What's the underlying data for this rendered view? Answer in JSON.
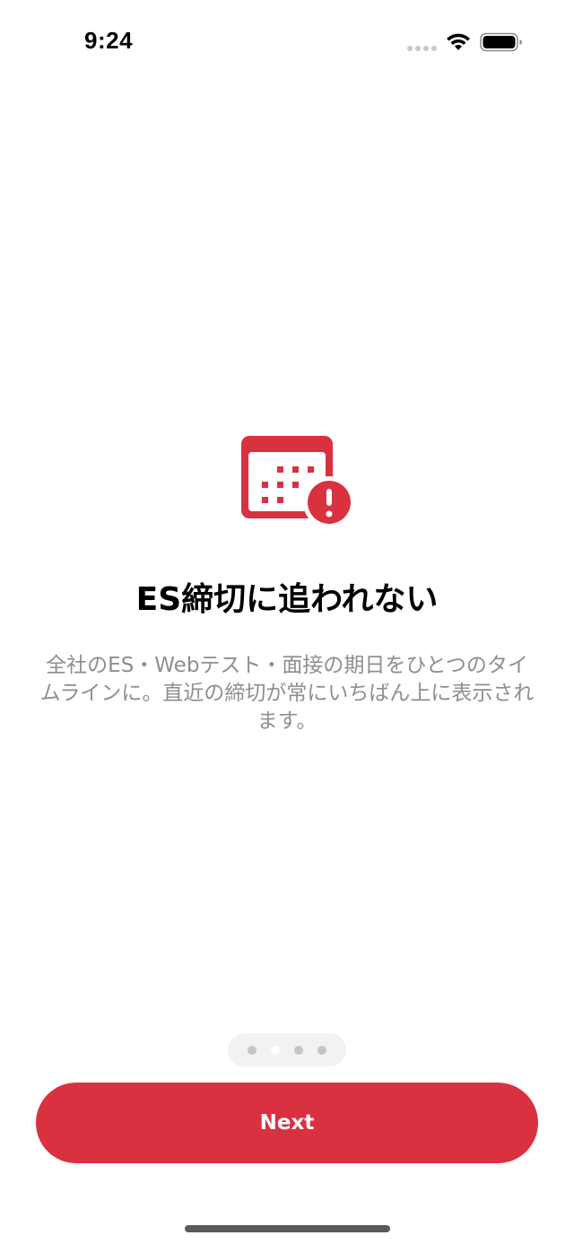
{
  "status_bar": {
    "time": "9:24",
    "signal_icon": "cellular-signal-dots",
    "wifi_icon": "wifi-icon",
    "battery_icon": "battery-icon"
  },
  "onboarding": {
    "icon": "calendar-alert-icon",
    "title": "ES締切に追われない",
    "description": "全社のES・Webテスト・面接の期日をひとつのタイムラインに。直近の締切が常にいちばん上に表示されます。",
    "page_indicator": {
      "total_pages": 4,
      "current_page": 2
    },
    "next_label": "Next"
  },
  "colors": {
    "accent": "#d93140",
    "title": "#000000",
    "description": "#8e8e93",
    "indicator_background": "#f2f2f2"
  }
}
